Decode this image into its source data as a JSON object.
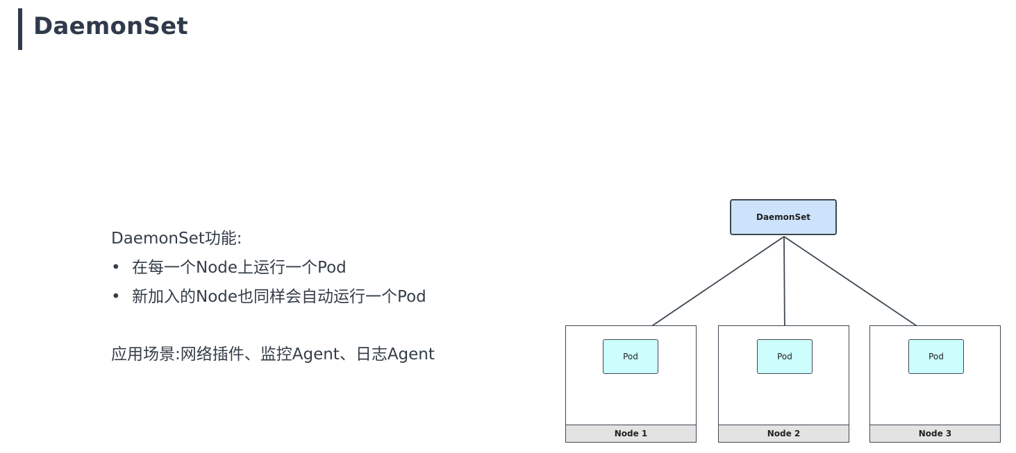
{
  "header": {
    "title": "DaemonSet"
  },
  "features": {
    "heading": "DaemonSet功能:",
    "bullet_symbol": "•",
    "items": [
      "在每一个Node上运行一个Pod",
      "新加入的Node也同样会自动运行一个Pod"
    ]
  },
  "scenario": "应用场景:网络插件、监控Agent、日志Agent",
  "diagram": {
    "controller_label": "DaemonSet",
    "nodes": [
      {
        "label": "Node 1",
        "pod_label": "Pod"
      },
      {
        "label": "Node 2",
        "pod_label": "Pod"
      },
      {
        "label": "Node 3",
        "pod_label": "Pod"
      }
    ],
    "colors": {
      "controller_fill": "#cde3fb",
      "pod_fill": "#cdfdfd",
      "node_label_fill": "#e3e3e3",
      "stroke": "#3d4650"
    }
  }
}
